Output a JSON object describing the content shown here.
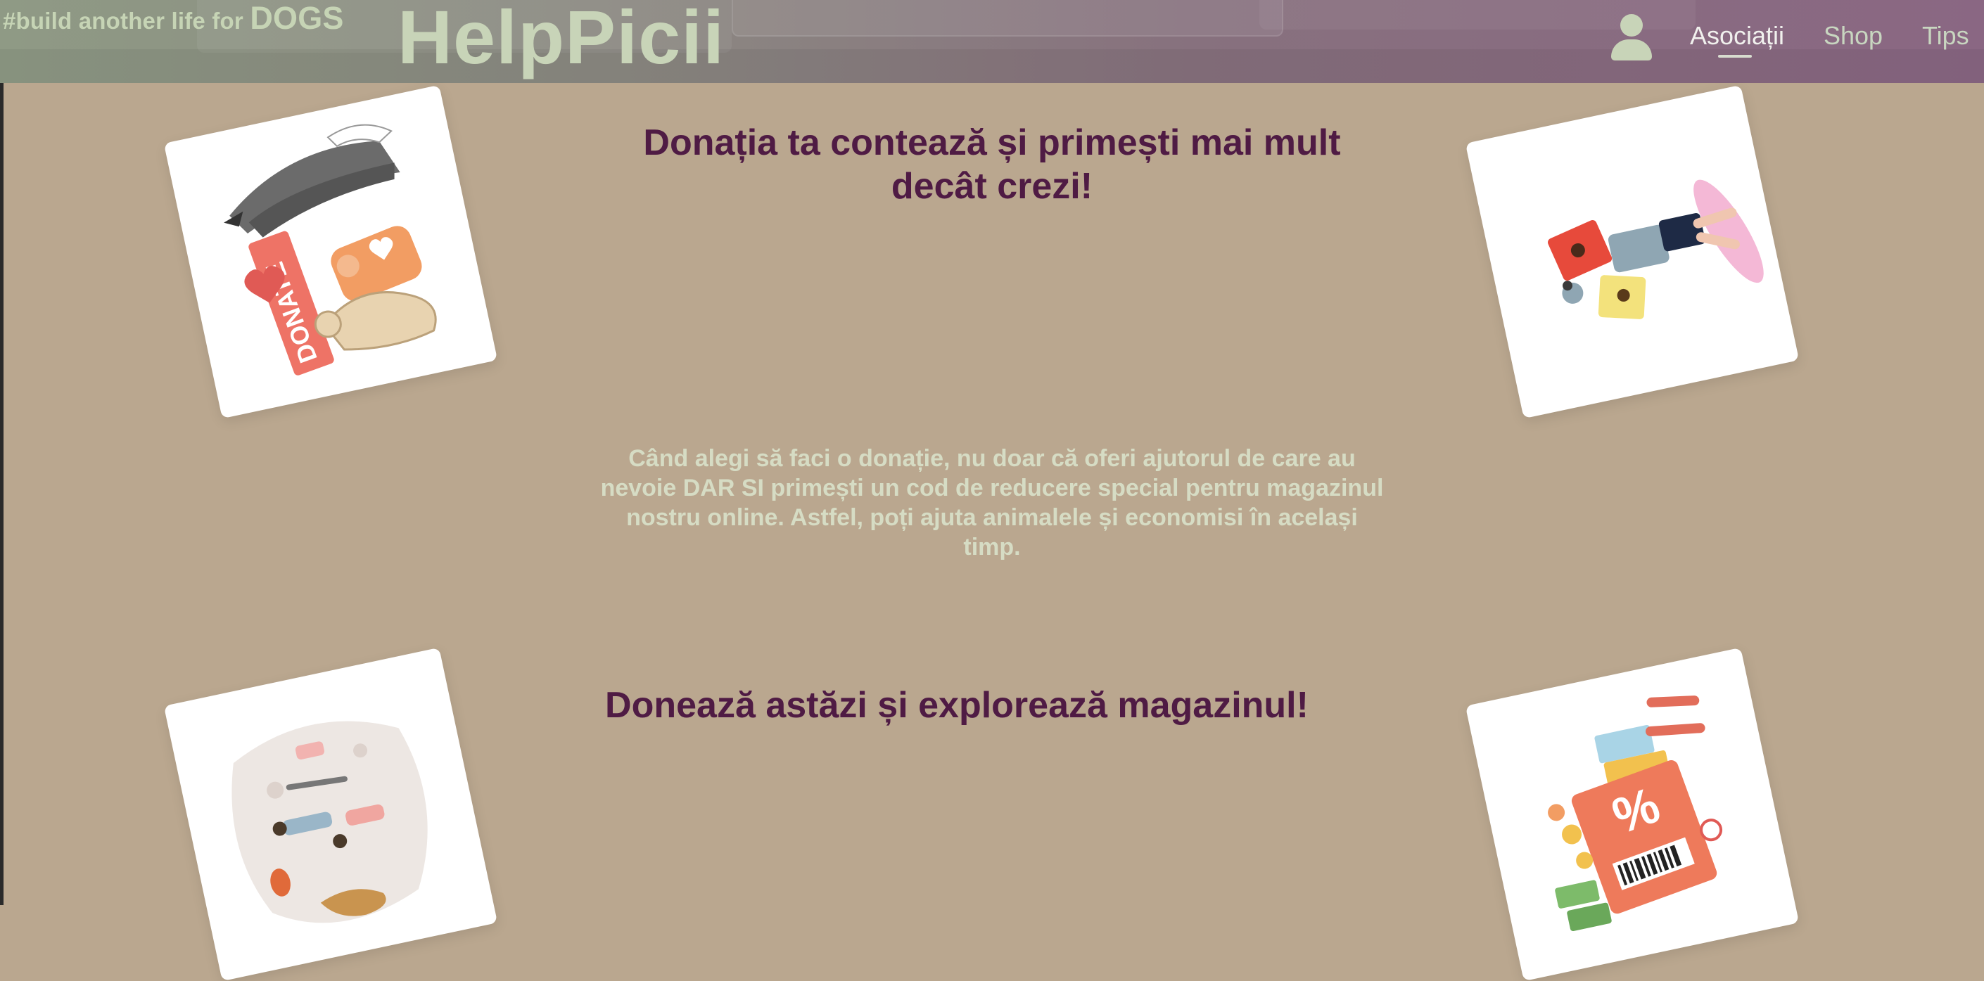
{
  "header": {
    "hashtag": "#build another life for ",
    "hashtag_emphasis": "DOGS",
    "logo": "HelpPicii",
    "nav": [
      {
        "label": "Asociații",
        "active": true
      },
      {
        "label": "Shop",
        "active": false
      },
      {
        "label": "Tips",
        "active": false
      }
    ]
  },
  "sections": [
    {
      "heading": "Donația ta contează și primești mai mult decât crezi!",
      "text": "Când alegi să faci o donație, nu doar că oferi ajutorul de care au nevoie DAR SI primești un cod de reducere special pentru magazinul nostru online. Astfel, poți ajuta animalele și economisi în același timp."
    },
    {
      "heading": "Donează astăzi și explorează magazinul!"
    }
  ],
  "illustrations": {
    "card1": {
      "label": "DONATE",
      "icon": "donate-illustration"
    },
    "card2": {
      "icon": "dog-shop-illustration"
    },
    "card3": {
      "icon": "walking-dog-illustration"
    },
    "card4": {
      "label": "%",
      "icon": "discount-coupon-illustration"
    }
  },
  "colors": {
    "background": "#baa78f",
    "heading": "#4f1b44",
    "paragraph": "#d6dcc4",
    "accent_text": "#c8d4b8"
  }
}
